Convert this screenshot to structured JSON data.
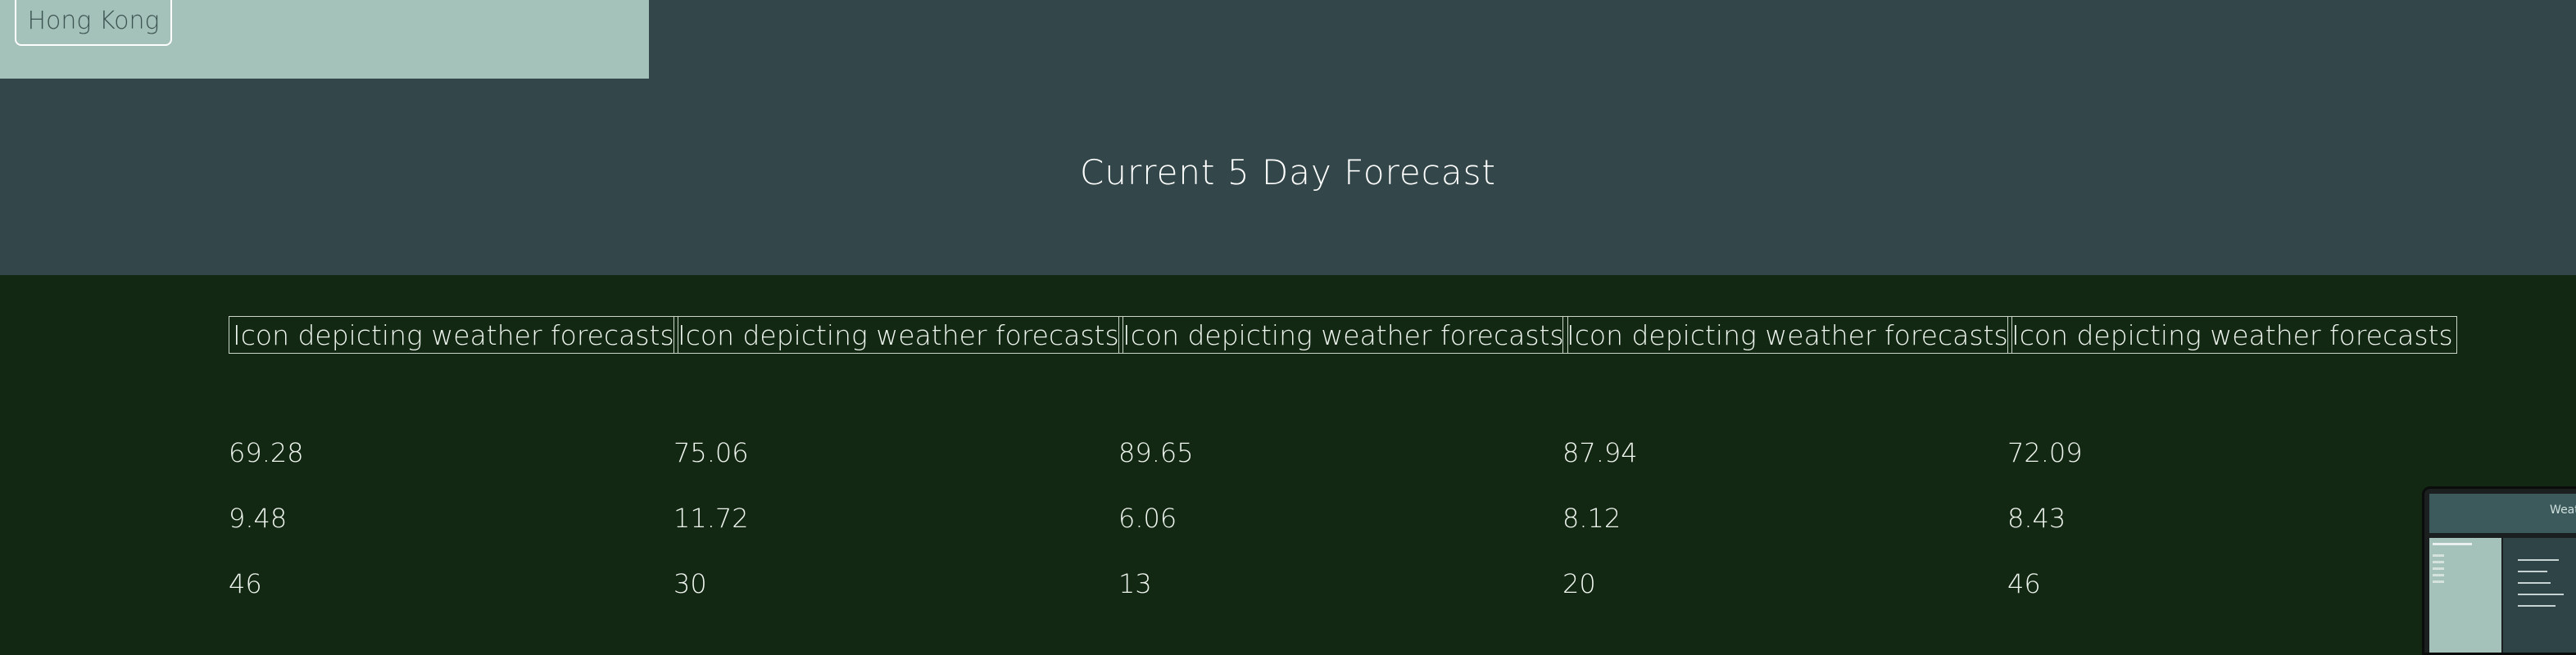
{
  "city_panel": {
    "city_button_label": "Hong Kong"
  },
  "forecast": {
    "title": "Current 5 Day Forecast",
    "days": [
      {
        "icon_alt": "Icon depicting weather forecasts",
        "temp": "69.28",
        "wind": "9.48",
        "humidity": "46"
      },
      {
        "icon_alt": "Icon depicting weather forecasts",
        "temp": "75.06",
        "wind": "11.72",
        "humidity": "30"
      },
      {
        "icon_alt": "Icon depicting weather forecasts",
        "temp": "89.65",
        "wind": "6.06",
        "humidity": "13"
      },
      {
        "icon_alt": "Icon depicting weather forecasts",
        "temp": "87.94",
        "wind": "8.12",
        "humidity": "20"
      },
      {
        "icon_alt": "Icon depicting weather forecasts",
        "temp": "72.09",
        "wind": "8.43",
        "humidity": "46"
      }
    ]
  },
  "preview": {
    "title": "Weather"
  },
  "colors": {
    "header_band": "#33474a",
    "forecast_band": "#132813",
    "city_panel": "#a4c2b9"
  }
}
